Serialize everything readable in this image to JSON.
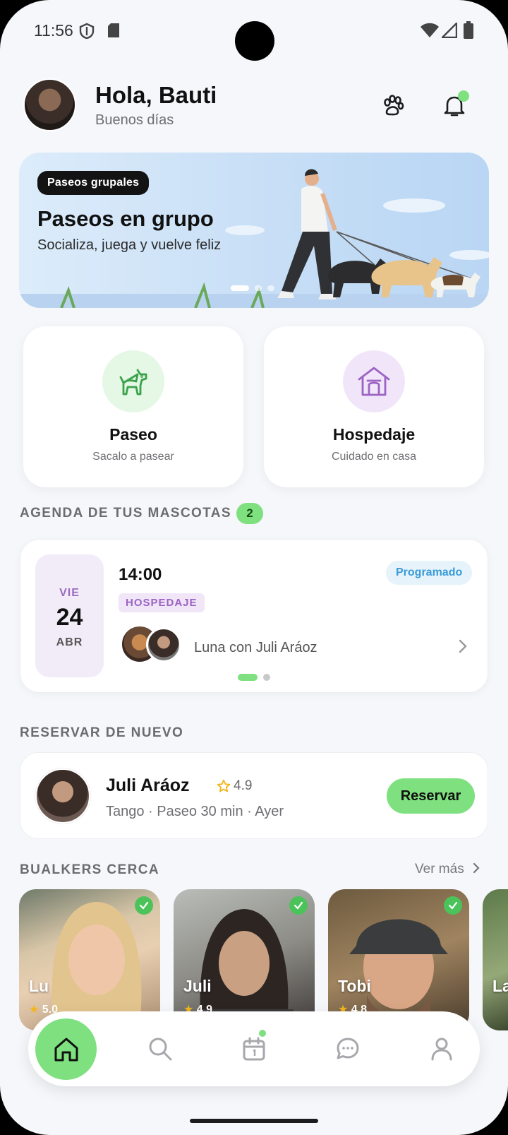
{
  "status_bar": {
    "time": "11:56"
  },
  "header": {
    "greeting": "Hola, Bauti",
    "subtitle": "Buenos días"
  },
  "banner": {
    "chip": "Paseos grupales",
    "title": "Paseos en grupo",
    "subtitle": "Socializa, juega y vuelve feliz"
  },
  "services": [
    {
      "title": "Paseo",
      "subtitle": "Sacalo a pasear",
      "icon": "dog-icon",
      "color": "#e5f7e5"
    },
    {
      "title": "Hospedaje",
      "subtitle": "Cuidado en casa",
      "icon": "house-icon",
      "color": "#f1e6f9"
    }
  ],
  "agenda": {
    "heading": "AGENDA DE TUS MASCOTAS",
    "count": "2",
    "item": {
      "dow": "VIE",
      "day": "24",
      "month": "ABR",
      "time": "14:00",
      "tag": "HOSPEDAJE",
      "status": "Programado",
      "who": "Luna con Juli Aráoz"
    }
  },
  "rebook": {
    "heading": "RESERVAR DE NUEVO",
    "name": "Juli Aráoz",
    "rating": "4.9",
    "meta": "Tango · Paseo 30 min · Ayer",
    "button": "Reservar"
  },
  "nearby": {
    "heading": "BUALKERS CERCA",
    "see_more": "Ver más",
    "walkers": [
      {
        "name": "Lu",
        "rating": "5.0"
      },
      {
        "name": "Juli",
        "rating": "4.9"
      },
      {
        "name": "Tobi",
        "rating": "4.8"
      },
      {
        "name": "La",
        "rating": ""
      }
    ]
  },
  "colors": {
    "accent": "#7ee07f",
    "purple": "#9c62c4",
    "blue": "#3a9bd8"
  }
}
